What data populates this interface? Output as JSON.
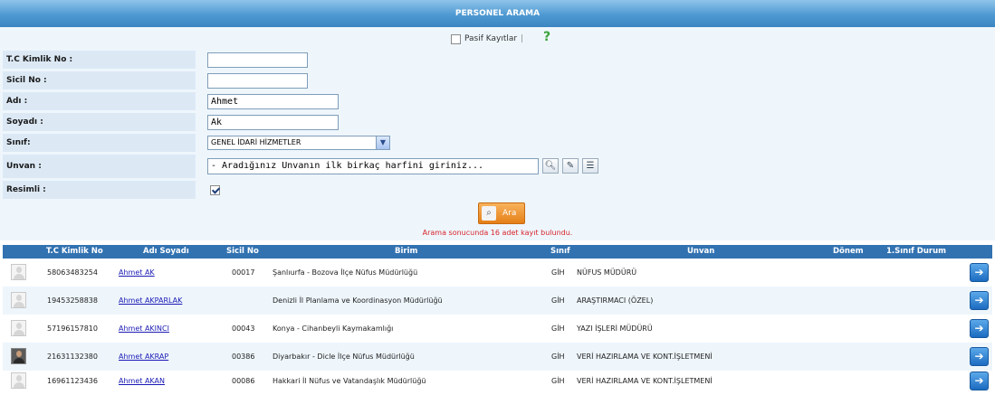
{
  "header": {
    "title": "PERSONEL ARAMA"
  },
  "filters": {
    "pasif_label": "Pasif Kayıtlar",
    "separator": "|",
    "help_icon": "question-mark-icon"
  },
  "form": {
    "tc_label": "T.C Kimlik No :",
    "tc_value": "",
    "sicil_label": "Sicil No :",
    "sicil_value": "",
    "adi_label": "Adı :",
    "adi_value": "Ahmet",
    "soyadi_label": "Soyadı :",
    "soyadi_value": "Ak",
    "sinif_label": "Sınıf:",
    "sinif_value": "GENEL İDARİ HİZMETLER",
    "unvan_label": "Unvan :",
    "unvan_value": "- Aradığınız Unvanın ilk birkaç harfini giriniz...",
    "resimli_label": "Resimli :",
    "resimli_checked": true
  },
  "search_button": {
    "label": "Ara"
  },
  "result_message": "Arama sonucunda 16 adet kayıt bulundu.",
  "table": {
    "headers": {
      "tc": "T.C Kimlik No",
      "adi": "Adı Soyadı",
      "sicil": "Sicil No",
      "birim": "Birim",
      "sinif": "Sınıf",
      "unvan": "Unvan",
      "donem": "Dönem",
      "durum": "1.Sınıf Durum"
    },
    "rows": [
      {
        "tc": "58063483254",
        "name": "Ahmet AK",
        "sicil": "00017",
        "birim": "Şanlıurfa - Bozova İlçe Nüfus Müdürlüğü",
        "sinif": "GİH",
        "unvan": "NÜFUS MÜDÜRÜ",
        "photo": false
      },
      {
        "tc": "19453258838",
        "name": "Ahmet AKPARLAK",
        "sicil": "",
        "birim": "Denizli İl Planlama ve Koordinasyon Müdürlüğü",
        "sinif": "GİH",
        "unvan": "ARAŞTIRMACI (ÖZEL)",
        "photo": false
      },
      {
        "tc": "57196157810",
        "name": "Ahmet AKINCI",
        "sicil": "00043",
        "birim": "Konya - Cihanbeyli Kaymakamlığı",
        "sinif": "GİH",
        "unvan": "YAZI İŞLERİ MÜDÜRÜ",
        "photo": false
      },
      {
        "tc": "21631132380",
        "name": "Ahmet AKRAP",
        "sicil": "00386",
        "birim": "Diyarbakır - Dicle İlçe Nüfus Müdürlüğü",
        "sinif": "GİH",
        "unvan": "VERİ HAZIRLAMA VE KONT.İŞLETMENİ",
        "photo": true
      },
      {
        "tc": "16961123436",
        "name": "Ahmet AKAN",
        "sicil": "00086",
        "birim": "Hakkari İl Nüfus ve Vatandaşlık Müdürlüğü",
        "sinif": "GİH",
        "unvan": "VERİ HAZIRLAMA VE KONT.İŞLETMENİ",
        "photo": false
      }
    ]
  }
}
